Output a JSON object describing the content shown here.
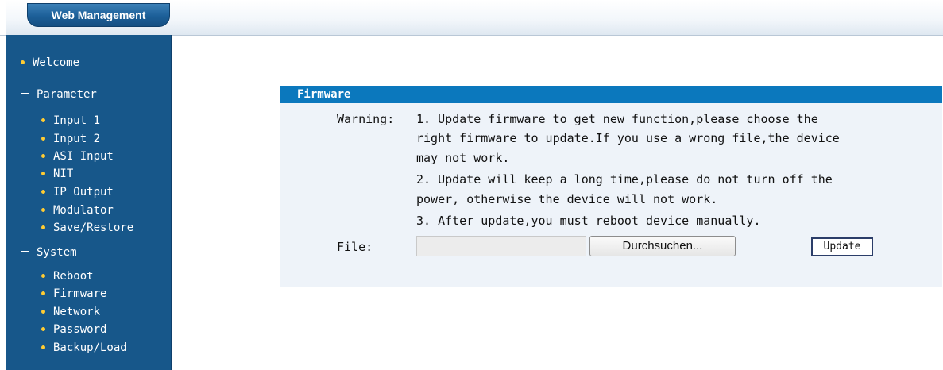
{
  "header": {
    "brand": "Web Management"
  },
  "sidebar": {
    "welcome": "Welcome",
    "parameter": {
      "label": "Parameter",
      "items": [
        "Input 1",
        "Input 2",
        "ASI Input",
        "NIT",
        "IP Output",
        "Modulator",
        "Save/Restore"
      ]
    },
    "system": {
      "label": "System",
      "items": [
        "Reboot",
        "Firmware",
        "Network",
        "Password",
        "Backup/Load"
      ]
    }
  },
  "panel": {
    "title": "Firmware",
    "warning_label": "Warning:",
    "warning_lines": [
      "1. Update firmware to get new function,please choose the",
      "right firmware to update.If you use a wrong file,the device",
      "may not work.",
      "2. Update will keep a long time,please do not turn off the",
      "power, otherwise the device will not work.",
      "3. After update,you must reboot device manually."
    ],
    "file_label": "File:",
    "file_value": "",
    "browse_label": "Durchsuchen...",
    "update_label": "Update"
  },
  "colors": {
    "sidebar_bg": "#17578a",
    "panel_header_bg": "#0b78bd",
    "panel_bg": "#eef3f9",
    "bullet": "#ffcc33"
  }
}
